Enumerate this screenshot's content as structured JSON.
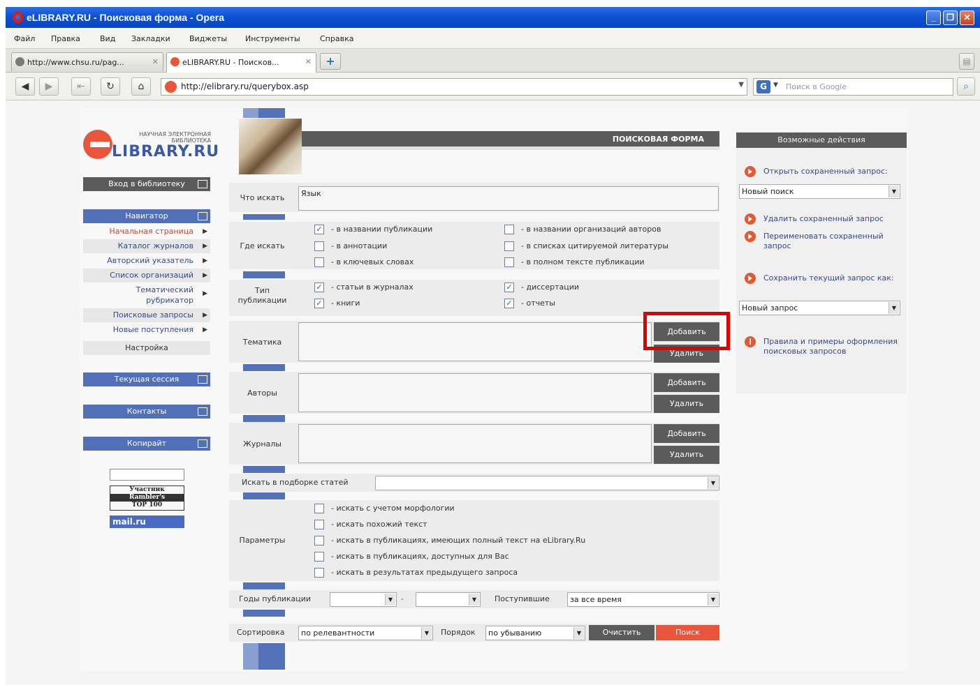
{
  "window": {
    "title": "eLIBRARY.RU - Поисковая форма - Opera"
  },
  "menu": [
    "Файл",
    "Правка",
    "Вид",
    "Закладки",
    "Виджеты",
    "Инструменты",
    "Справка"
  ],
  "tabs": [
    {
      "label": "http://www.chsu.ru/pag..."
    },
    {
      "label": "eLIBRARY.RU - Поисков..."
    }
  ],
  "address": {
    "url": "http://elibrary.ru/querybox.asp"
  },
  "search": {
    "placeholder": "Поиск в Google"
  },
  "logo": {
    "line1": "НАУЧНАЯ ЭЛЕКТРОННАЯ",
    "line2": "БИБЛИОТЕКА",
    "brand": "LIBRARY.RU"
  },
  "sidebar": {
    "login": "Вход в библиотеку",
    "navigator": "Навигатор",
    "items": [
      {
        "label": "Начальная страница"
      },
      {
        "label": "Каталог журналов"
      },
      {
        "label": "Авторский указатель"
      },
      {
        "label": "Список организаций"
      },
      {
        "label": "Тематический рубрикатор"
      },
      {
        "label": "Поисковые запросы"
      },
      {
        "label": "Новые поступления"
      },
      {
        "label": "Настройка"
      }
    ],
    "session": "Текущая сессия",
    "contacts": "Контакты",
    "copyright": "Копирайт",
    "rambler": [
      "Участник",
      "Rambler's",
      "TOP 100"
    ],
    "mail": "mail.ru"
  },
  "form": {
    "header": "ПОИСКОВАЯ ФОРМА",
    "what_label": "Что искать",
    "what_value": "Язык",
    "where_label": "Где искать",
    "where_opts": [
      {
        "label": "- в названии публикации",
        "checked": true
      },
      {
        "label": "- в аннотации",
        "checked": false
      },
      {
        "label": "- в ключевых словах",
        "checked": false
      },
      {
        "label": "- в названии организаций авторов",
        "checked": false
      },
      {
        "label": "- в списках цитируемой литературы",
        "checked": false
      },
      {
        "label": "- в полном тексте публикации",
        "checked": false
      }
    ],
    "type_label": "Тип публикации",
    "type_opts": [
      {
        "label": "- статьи в журналах",
        "checked": true
      },
      {
        "label": "- книги",
        "checked": true
      },
      {
        "label": "- диссертации",
        "checked": true
      },
      {
        "label": "- отчеты",
        "checked": true
      }
    ],
    "topic_label": "Тематика",
    "authors_label": "Авторы",
    "journals_label": "Журналы",
    "add_label": "Добавить",
    "remove_label": "Удалить",
    "collection_label": "Искать в подборке статей",
    "params_label": "Параметры",
    "params": [
      "- искать с учетом морфологии",
      "- искать похожий текст",
      "- искать в публикациях, имеющих полный текст на eLibrary.Ru",
      "- искать в публикациях, доступных для Вас",
      "- искать в результатах предыдущего запроса"
    ],
    "years_label": "Годы публикации",
    "years_dash": "-",
    "received_label": "Поступившие",
    "received_value": "за все время",
    "sort_label": "Сортировка",
    "sort_value": "по релевантности",
    "order_label": "Порядок",
    "order_value": "по убыванию",
    "clear_label": "Очистить",
    "search_label": "Поиск"
  },
  "actions": {
    "header": "Возможные действия",
    "open_saved": "Открыть сохраненный запрос:",
    "open_select": "Новый поиск",
    "delete_saved": "Удалить сохраненный запрос",
    "rename_saved": "Переименовать сохраненный запрос",
    "save_current": "Сохранить текущий запрос как:",
    "save_select": "Новый запрос",
    "rules": "Правила и примеры оформления поисковых запросов"
  },
  "colors": {
    "accent": "#e8553a",
    "nav_blue": "#5472b8",
    "highlight": "#e00000"
  }
}
